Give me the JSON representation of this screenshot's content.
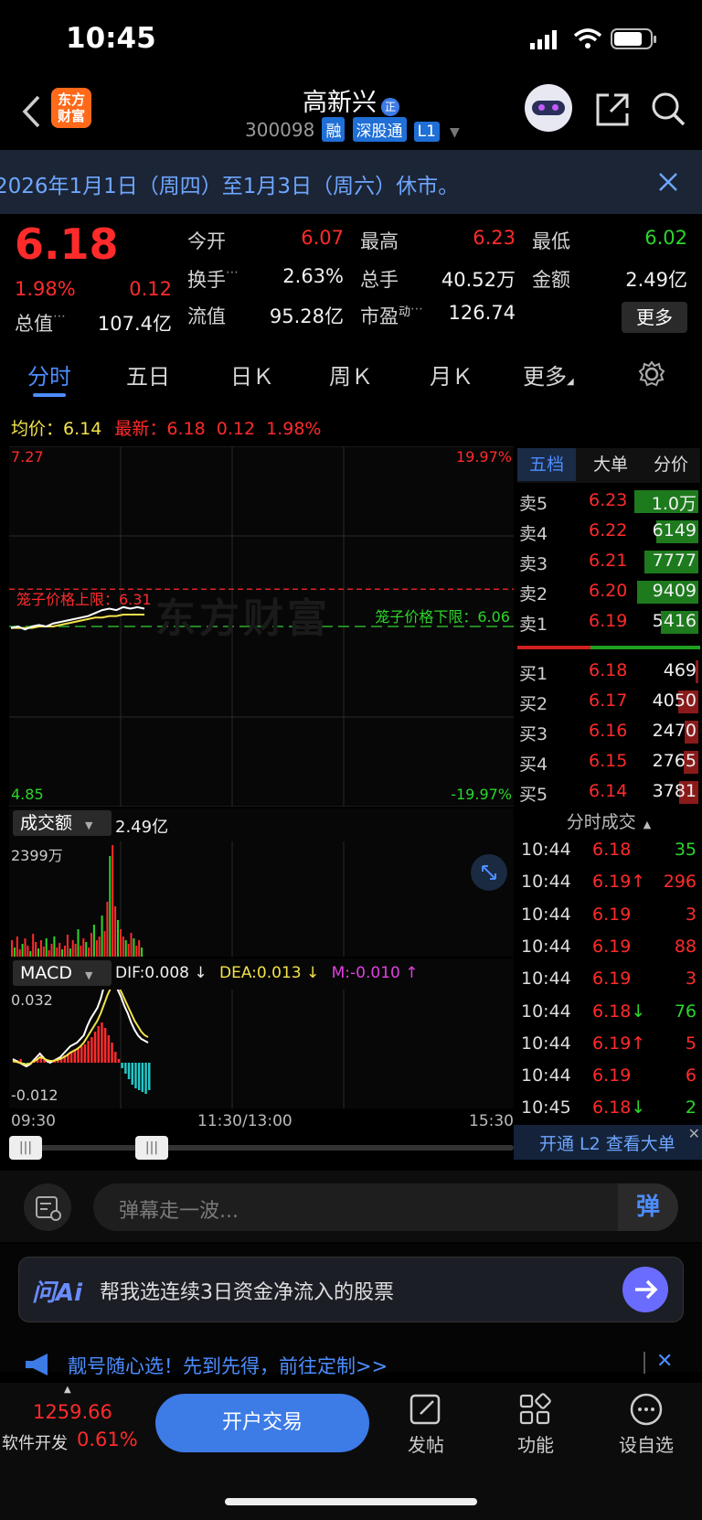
{
  "status": {
    "time": "10:45"
  },
  "header": {
    "title": "高新兴",
    "code": "300098",
    "badges": [
      "融",
      "深股通",
      "L1"
    ],
    "app_logo": "东方\n财富"
  },
  "notice": {
    "text": "2026年1月1日（周四）至1月3日（周六）休市。"
  },
  "quote": {
    "price": "6.18",
    "change_pct": "1.98%",
    "change": "0.12",
    "open_label": "今开",
    "open": "6.07",
    "high_label": "最高",
    "high": "6.23",
    "low_label": "最低",
    "low": "6.02",
    "turnover_label": "换手",
    "turnover": "2.63%",
    "volume_label": "总手",
    "volume": "40.52万",
    "amount_label": "金额",
    "amount": "2.49亿",
    "mcap_label": "总值",
    "mcap": "107.4亿",
    "float_label": "流值",
    "float": "95.28亿",
    "pe_label": "市盈",
    "pe_sup": "动",
    "pe": "126.74",
    "more_button": "更多"
  },
  "tabs": [
    "分时",
    "五日",
    "日Ｋ",
    "周Ｋ",
    "月Ｋ",
    "更多"
  ],
  "chart_info": {
    "avg_label": "均价：",
    "avg": "6.14",
    "latest_label": "最新：",
    "latest": "6.18",
    "latest_change": "0.12",
    "latest_pct": "1.98%"
  },
  "chart_data": {
    "type": "line",
    "y_top_label": "7.27",
    "y_bottom_label": "4.85",
    "pct_top_label": "19.97%",
    "pct_bottom_label": "-19.97%",
    "cage_upper_label": "笼子价格上限：6.31",
    "cage_lower_label": "笼子价格下限：6.06",
    "watermark": "东方财富",
    "ylim": [
      4.85,
      7.27
    ],
    "prev_close": 6.06,
    "cage_upper": 6.31,
    "cage_lower": 6.06,
    "price": [
      6.05,
      6.06,
      6.04,
      6.06,
      6.07,
      6.06,
      6.08,
      6.09,
      6.1,
      6.11,
      6.12,
      6.13,
      6.15,
      6.17,
      6.18,
      6.17,
      6.19,
      6.18,
      6.19,
      6.18
    ],
    "avg_price": [
      6.05,
      6.05,
      6.05,
      6.05,
      6.06,
      6.06,
      6.06,
      6.07,
      6.08,
      6.09,
      6.1,
      6.11,
      6.12,
      6.12,
      6.13,
      6.13,
      6.14,
      6.14,
      6.14,
      6.14
    ],
    "x_ticks": [
      "09:30",
      "11:30/13:00",
      "15:30"
    ]
  },
  "volume_panel": {
    "selector": "成交额",
    "total": "2.49亿",
    "max_label": "2399万"
  },
  "macd_panel": {
    "selector": "MACD",
    "dif": "DIF:0.008 ↓",
    "dea": "DEA:0.013 ↓",
    "m": "M:-0.010 ↑",
    "top_label": "0.032",
    "bottom_label": "-0.012"
  },
  "orderbook": {
    "tabs": [
      "五档",
      "大单",
      "分价"
    ],
    "asks": [
      {
        "label": "卖5",
        "price": "6.23",
        "vol": "1.0万",
        "bar": 0.95
      },
      {
        "label": "卖4",
        "price": "6.22",
        "vol": "6149",
        "bar": 0.62
      },
      {
        "label": "卖3",
        "price": "6.21",
        "vol": "7777",
        "bar": 0.8
      },
      {
        "label": "卖2",
        "price": "6.20",
        "vol": "9409",
        "bar": 0.9
      },
      {
        "label": "卖1",
        "price": "6.19",
        "vol": "5416",
        "bar": 0.55
      }
    ],
    "bids": [
      {
        "label": "买1",
        "price": "6.18",
        "vol": "469",
        "bar": 0.04
      },
      {
        "label": "买2",
        "price": "6.17",
        "vol": "4050",
        "bar": 0.3
      },
      {
        "label": "买3",
        "price": "6.16",
        "vol": "2470",
        "bar": 0.2
      },
      {
        "label": "买4",
        "price": "6.15",
        "vol": "2765",
        "bar": 0.22
      },
      {
        "label": "买5",
        "price": "6.14",
        "vol": "3781",
        "bar": 0.28
      }
    ]
  },
  "trades": {
    "title": "分时成交",
    "rows": [
      {
        "time": "10:44",
        "price": "6.18",
        "arrow": "",
        "vol": "35",
        "color": "green"
      },
      {
        "time": "10:44",
        "price": "6.19",
        "arrow": "↑",
        "vol": "296",
        "color": "red"
      },
      {
        "time": "10:44",
        "price": "6.19",
        "arrow": "",
        "vol": "3",
        "color": "red"
      },
      {
        "time": "10:44",
        "price": "6.19",
        "arrow": "",
        "vol": "88",
        "color": "red"
      },
      {
        "time": "10:44",
        "price": "6.19",
        "arrow": "",
        "vol": "3",
        "color": "red"
      },
      {
        "time": "10:44",
        "price": "6.18",
        "arrow": "↓",
        "vol": "76",
        "color": "green"
      },
      {
        "time": "10:44",
        "price": "6.19",
        "arrow": "↑",
        "vol": "5",
        "color": "red"
      },
      {
        "time": "10:44",
        "price": "6.19",
        "arrow": "",
        "vol": "6",
        "color": "red"
      },
      {
        "time": "10:45",
        "price": "6.18",
        "arrow": "↓",
        "vol": "2",
        "color": "green"
      }
    ],
    "l2_banner": "开通 L2 查看大单"
  },
  "danmaku": {
    "placeholder": "弹幕走一波...",
    "button": "弹"
  },
  "ai": {
    "logo": "问Ai",
    "prompt": "帮我选连续3日资金净流入的股票"
  },
  "promo": {
    "text": "靓号随心选！先到先得，前往定制>>"
  },
  "bottom": {
    "index_value": "1259.66",
    "index_name": "软件开发",
    "index_pct": "0.61%",
    "trade_button": "开户交易",
    "post": "发帖",
    "function": "功能",
    "watchlist": "设自选"
  },
  "colors": {
    "up": "#ff2b2b",
    "down": "#2bd62b",
    "accent": "#1f6fd6",
    "cage": "#e02020"
  }
}
